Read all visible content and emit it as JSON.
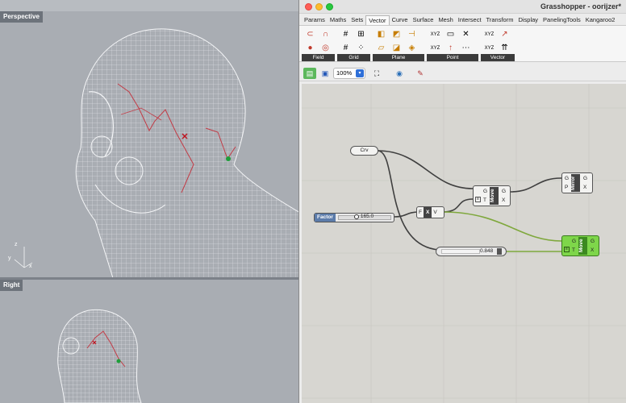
{
  "rhino": {
    "viewports": [
      {
        "label": "Perspective"
      },
      {
        "label": "Right"
      }
    ],
    "axis_labels": {
      "z": "z",
      "y": "y",
      "x": "x"
    }
  },
  "grasshopper": {
    "title": "Grasshopper - oorijzer*",
    "tabs": [
      "Params",
      "Maths",
      "Sets",
      "Vector",
      "Curve",
      "Surface",
      "Mesh",
      "Intersect",
      "Transform",
      "Display",
      "PanelingTools",
      "Kangaroo2"
    ],
    "active_tab": "Vector",
    "ribbon_panels": [
      {
        "label": "Field",
        "icons": [
          "field-magnet-icon",
          "field-line-icon",
          "field-point-icon",
          "field-spin-icon"
        ]
      },
      {
        "label": "Grid",
        "icons": [
          "grid-square-icon",
          "grid-hex-icon",
          "grid-rect-icon",
          "grid-populate-icon"
        ]
      },
      {
        "label": "Plane",
        "icons": [
          "plane-origin-icon",
          "plane-align-icon",
          "plane-normal-icon",
          "plane-xy-icon",
          "plane-offset-icon",
          "plane-rotate-icon"
        ]
      },
      {
        "label": "Point",
        "icons": [
          "point-decompose-icon",
          "point-construct-icon",
          "point-distance-icon",
          "point-cull-icon",
          "point-project-icon",
          "point-sort-icon"
        ]
      },
      {
        "label": "Vector",
        "icons": [
          "vector-xyz-icon",
          "vector-2pt-icon",
          "vector-decompose-icon",
          "vector-amplitude-icon"
        ]
      }
    ],
    "toolbar": {
      "zoom": "100%"
    },
    "canvas": {
      "crv_label": "Crv",
      "factor_label": "Factor",
      "factor_value": "165.0",
      "panel_value": "0.848",
      "move1": {
        "title": "Move",
        "inputs": [
          "G",
          "T"
        ],
        "outputs": [
          "G",
          "X"
        ]
      },
      "mirror": {
        "title": "Mirror",
        "inputs": [
          "G",
          "P"
        ],
        "outputs": [
          "G",
          "X"
        ]
      },
      "multiply": {
        "title": "X",
        "inputs": [
          "F"
        ],
        "outputs": [
          "V"
        ]
      },
      "move2": {
        "title": "Move",
        "inputs": [
          "G",
          "T"
        ],
        "outputs": [
          "G",
          "X"
        ]
      }
    },
    "colors": {
      "wire_dark": "#3f3f3f",
      "wire_green": "#7fa83d",
      "node_selected": "#7ed64a",
      "ribbon_label": "#3b3b3b"
    }
  }
}
